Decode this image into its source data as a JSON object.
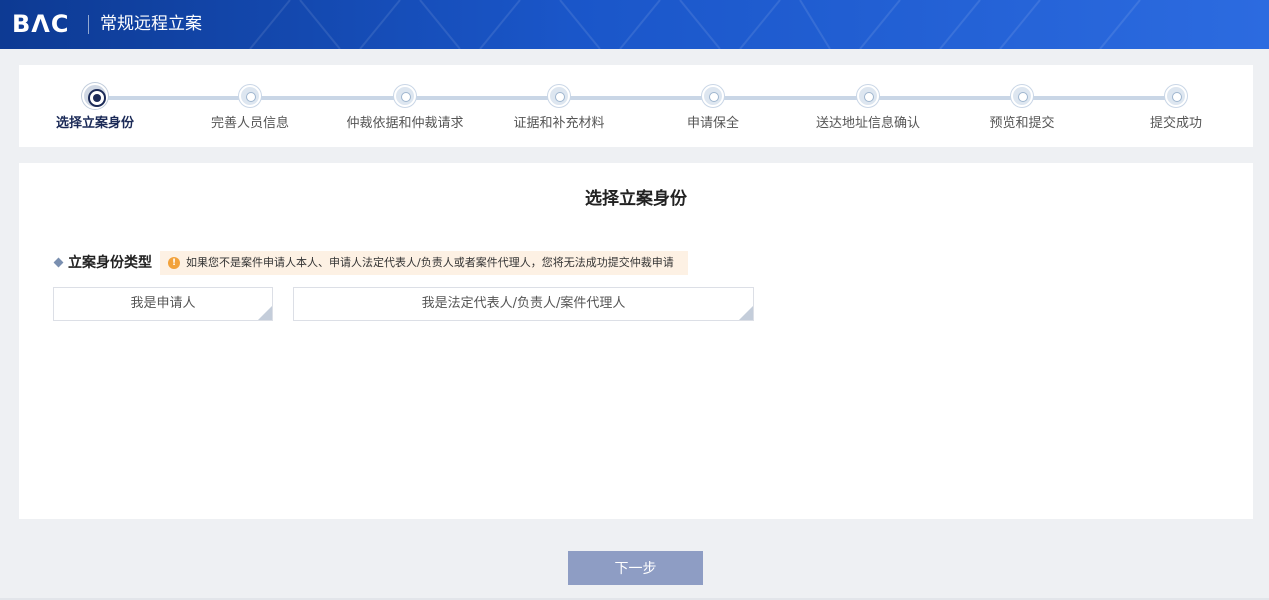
{
  "header": {
    "logo_text": "BΛC",
    "title": "常规远程立案"
  },
  "steps": [
    {
      "label": "选择立案身份",
      "active": true
    },
    {
      "label": "完善人员信息",
      "active": false
    },
    {
      "label": "仲裁依据和仲裁请求",
      "active": false
    },
    {
      "label": "证据和补充材料",
      "active": false
    },
    {
      "label": "申请保全",
      "active": false
    },
    {
      "label": "送达地址信息确认",
      "active": false
    },
    {
      "label": "预览和提交",
      "active": false
    },
    {
      "label": "提交成功",
      "active": false
    }
  ],
  "main": {
    "title": "选择立案身份",
    "field_label": "立案身份类型",
    "warning_icon": "warning-icon",
    "warning": "如果您不是案件申请人本人、申请人法定代表人/负责人或者案件代理人，您将无法成功提交仲裁申请",
    "options": [
      {
        "label": "我是申请人"
      },
      {
        "label": "我是法定代表人/负责人/案件代理人"
      }
    ]
  },
  "footer": {
    "next_label": "下一步"
  },
  "colors": {
    "header_start": "#0d3a93",
    "header_end": "#2c6be0",
    "active_step": "#1b2a57",
    "warning_bg": "#fdf1e4",
    "warning_icon": "#f2a23c",
    "next_button": "#8e9dc4"
  }
}
